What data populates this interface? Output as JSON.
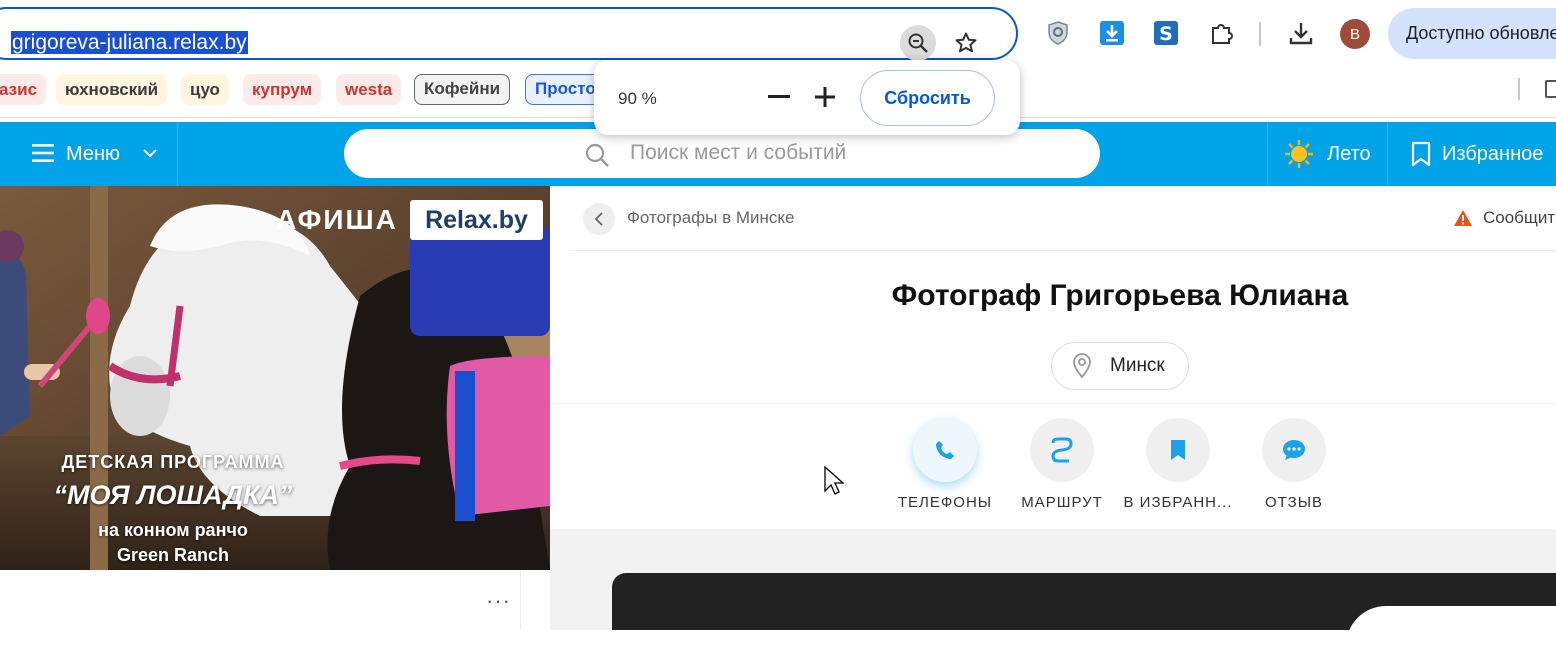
{
  "browser": {
    "url": "grigoreva-juliana.relax.by",
    "update_button": "Доступно обновле",
    "profile_initial": "В",
    "extension_icons": [
      "shield-icon",
      "download-arrow-icon",
      "s-icon",
      "puzzle-icon",
      "download-icon"
    ]
  },
  "bookmarks": [
    {
      "label": "азис",
      "style": "red"
    },
    {
      "label": "юхновский",
      "style": "dark"
    },
    {
      "label": "цуо",
      "style": "dark"
    },
    {
      "label": "купрум",
      "style": "red"
    },
    {
      "label": "westa",
      "style": "red"
    },
    {
      "label": "Кофейни",
      "style": "outline"
    },
    {
      "label": "Просто",
      "style": "blue"
    }
  ],
  "zoom_popup": {
    "level": "90 %",
    "minus": "−",
    "plus": "+",
    "reset": "Сбросить"
  },
  "site_header": {
    "menu_label": "Меню",
    "search_placeholder": "Поиск мест и событий",
    "season_label": "Лето",
    "favorites_label": "Избранное"
  },
  "banner": {
    "brand_afisha": "АФИША",
    "brand_relax": "Relax.by",
    "line1": "ДЕТСКАЯ ПРОГРАММА",
    "line2": "“МОЯ ЛОШАДКА”",
    "line3": "на конном ранчо",
    "line4": "Green Ranch"
  },
  "page": {
    "breadcrumb": "Фотографы в Минске",
    "report_label": "Сообщит",
    "title": "Фотограф Григорьева Юлиана",
    "city": "Минск",
    "actions": [
      {
        "label": "ТЕЛЕФОНЫ",
        "icon": "phone-icon"
      },
      {
        "label": "МАРШРУТ",
        "icon": "route-icon"
      },
      {
        "label": "В ИЗБРАНН...",
        "icon": "bookmark-icon"
      },
      {
        "label": "ОТЗЫВ",
        "icon": "chat-icon"
      }
    ],
    "more_label": "···"
  },
  "colors": {
    "header_blue": "#00a2e8",
    "accent_blue": "#0b57d0",
    "icon_blue": "#1aa3e8"
  }
}
